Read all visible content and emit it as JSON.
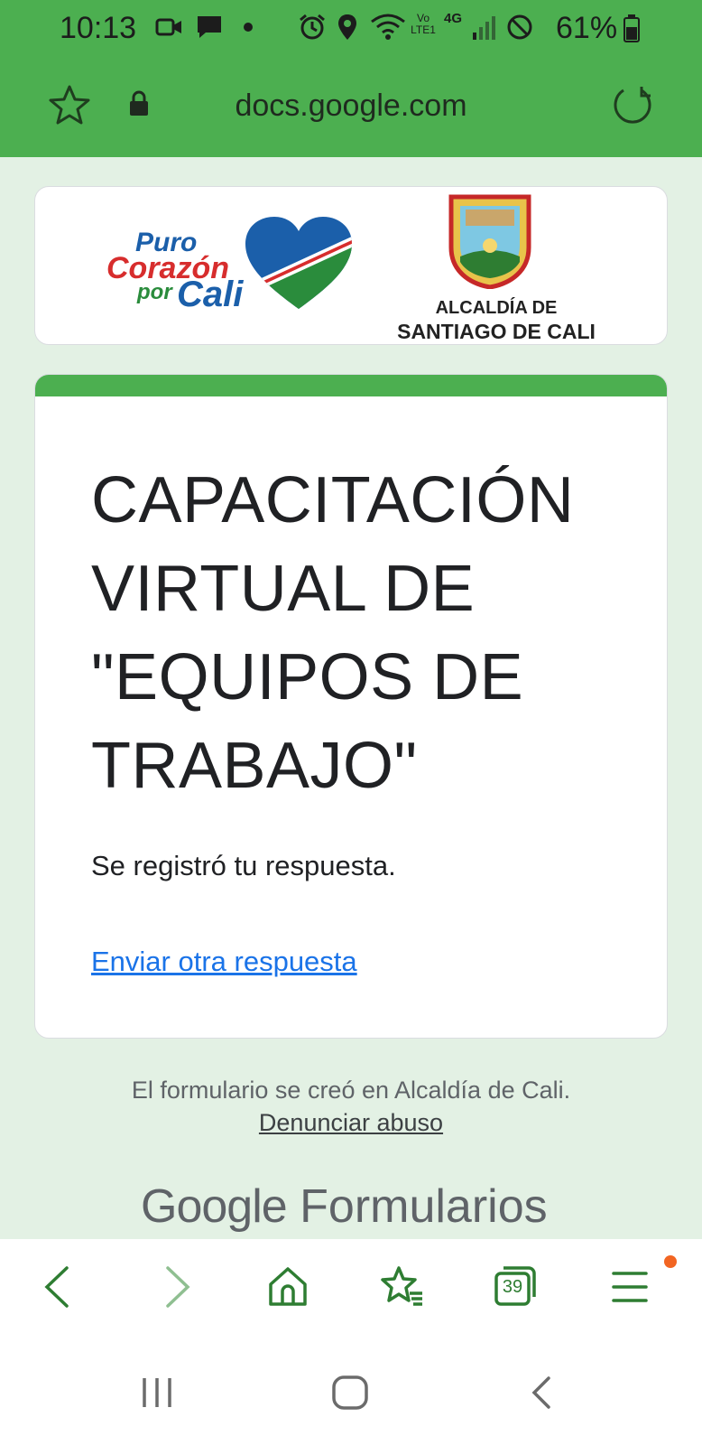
{
  "status_bar": {
    "time": "10:13",
    "battery": "61%",
    "network_badges": [
      "Vo LTE1",
      "4G"
    ]
  },
  "browser": {
    "url": "docs.google.com"
  },
  "banner": {
    "campaign_line1": "Puro",
    "campaign_line2": "Corazón",
    "campaign_line3a": "por",
    "campaign_line3b": "Cali",
    "org_line1": "ALCALDÍA DE",
    "org_line2": "SANTIAGO DE CALI"
  },
  "form": {
    "title": "CAPACITACIÓN VIRTUAL DE \"EQUIPOS DE TRABAJO\"",
    "confirmation": "Se registró tu respuesta.",
    "submit_another": "Enviar otra respuesta"
  },
  "footer": {
    "created_in": "El formulario se creó en Alcaldía de Cali.",
    "report_abuse": "Denunciar abuso",
    "brand_google": "Google",
    "brand_product": "Formularios"
  },
  "nav": {
    "tabs_count": "39"
  },
  "colors": {
    "accent": "#4caf50",
    "link": "#1a73e8",
    "page_bg": "#e3f1e4",
    "nav_icon": "#2e7d32"
  }
}
